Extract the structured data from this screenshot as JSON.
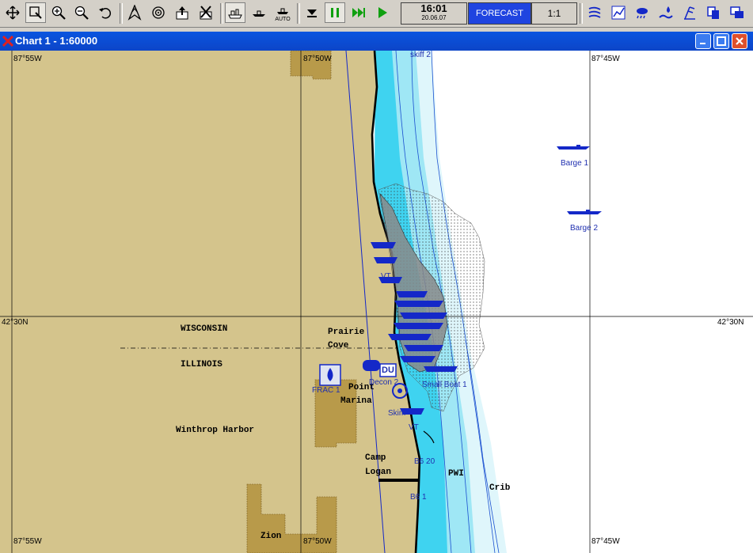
{
  "toolbar": {
    "icons": [
      "pan-icon",
      "select-zoom-icon",
      "zoom-in-icon",
      "zoom-out-icon",
      "undo-icon",
      "north-arrow-icon",
      "target-icon",
      "export-icon",
      "delete-icon",
      "vessel-icon",
      "ship-icon",
      "auto-icon",
      "stop-icon",
      "pause-icon",
      "fast-forward-icon",
      "play-icon",
      "current-icon",
      "graph-icon",
      "weather-icon",
      "spill-icon",
      "wind-icon",
      "copy-icon",
      "windows-icon"
    ],
    "auto_label": "AUTO",
    "time": "16:01",
    "date": "20.06.07",
    "forecast_label": "FORECAST",
    "ratio_label": "1:1"
  },
  "window": {
    "title": "Chart 1 - 1:60000"
  },
  "map": {
    "coords": {
      "top_left": "87°55W",
      "top_mid": "87°50W",
      "top_right": "87°45W",
      "bottom_left": "87°55W",
      "bottom_mid": "87°50W",
      "bottom_right": "87°45W",
      "left_lat": "42°30N",
      "right_lat": "42°30N"
    },
    "places": {
      "wisconsin": "WISCONSIN",
      "illinois": "ILLINOIS",
      "prairie": "Prairie",
      "cove": "Cove",
      "point": "Point",
      "marina": "Marina",
      "winthrop": "Winthrop Harbor",
      "camp": "Camp",
      "logan": "Logan",
      "zion": "Zion",
      "pwi": "PWI",
      "crib": "Crib"
    },
    "targets": {
      "barge1": "Barge 1",
      "barge2": "Barge 2",
      "frac": "FRAC 1",
      "decon": "Decon 2",
      "smallboat": "Small Boat 1",
      "skim": "Skim",
      "vt": "VT",
      "b620": "B6 20",
      "b61": "B6 1",
      "du": "DU",
      "skiff": "skiff 2"
    },
    "colors": {
      "land": "#d4c48c",
      "urban": "#b89a4a",
      "shallow": "#3fd3f0",
      "mid": "#9fe7f5",
      "deep": "#dff6fb",
      "offshore": "#ffffff",
      "spill": "#8a8a8a",
      "vessel": "#1428c8"
    }
  }
}
